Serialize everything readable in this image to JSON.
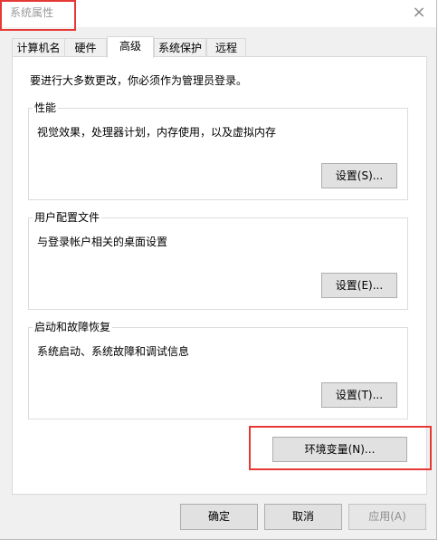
{
  "window": {
    "title": "系统属性",
    "close_icon": "×"
  },
  "tabs": [
    {
      "label": "计算机名",
      "active": false
    },
    {
      "label": "硬件",
      "active": false
    },
    {
      "label": "高级",
      "active": true
    },
    {
      "label": "系统保护",
      "active": false
    },
    {
      "label": "远程",
      "active": false
    }
  ],
  "advanced": {
    "intro": "要进行大多数更改，你必须作为管理员登录。",
    "performance": {
      "title": "性能",
      "description": "视觉效果，处理器计划，内存使用，以及虚拟内存",
      "button": "设置(S)..."
    },
    "user_profiles": {
      "title": "用户配置文件",
      "description": "与登录帐户相关的桌面设置",
      "button": "设置(E)..."
    },
    "startup_recovery": {
      "title": "启动和故障恢复",
      "description": "系统启动、系统故障和调试信息",
      "button": "设置(T)..."
    },
    "env_button": "环境变量(N)..."
  },
  "footer": {
    "ok": "确定",
    "cancel": "取消",
    "apply": "应用(A)"
  },
  "colors": {
    "highlight": "#e53935",
    "window_bg": "#f0f0f0",
    "panel_bg": "#ffffff",
    "button_bg": "#e1e1e1",
    "disabled_text": "#8d8d8d"
  }
}
